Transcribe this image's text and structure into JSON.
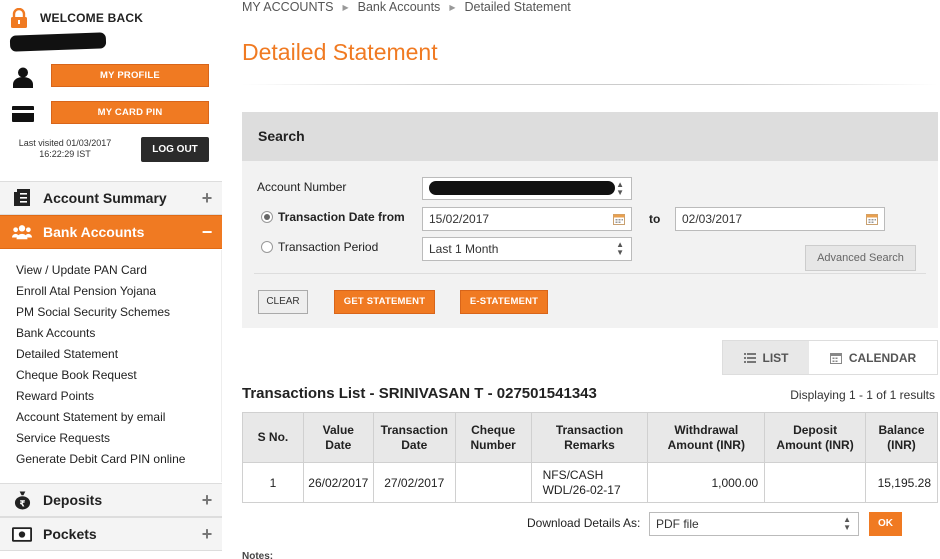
{
  "sidebar": {
    "welcome": "WELCOME BACK",
    "my_profile": "MY PROFILE",
    "my_card_pin": "MY CARD PIN",
    "last_visited_line1": "Last visited 01/03/2017",
    "last_visited_line2": "16:22:29 IST",
    "logout": "LOG OUT",
    "nav": {
      "account_summary": "Account Summary",
      "bank_accounts": "Bank Accounts",
      "deposits": "Deposits",
      "pockets": "Pockets",
      "collapsed_sign": "+",
      "expanded_sign": "−"
    },
    "sub_items": [
      "View / Update PAN Card",
      "Enroll Atal Pension Yojana",
      "PM Social Security Schemes",
      "Bank Accounts",
      "Detailed Statement",
      "Cheque Book Request",
      "Reward Points",
      "Account Statement by email",
      "Service Requests",
      "Generate Debit Card PIN online"
    ]
  },
  "breadcrumb": [
    "MY ACCOUNTS",
    "Bank Accounts",
    "Detailed Statement"
  ],
  "page_title": "Detailed Statement",
  "search": {
    "heading": "Search",
    "account_number_label": "Account Number",
    "date_from_label": "Transaction Date from",
    "date_from": "15/02/2017",
    "to_label": "to",
    "date_to": "02/03/2017",
    "period_label": "Transaction Period",
    "period_value": "Last 1 Month",
    "advanced": "Advanced Search",
    "clear": "CLEAR",
    "get_statement": "GET STATEMENT",
    "e_statement": "E-STATEMENT"
  },
  "view_toggle": {
    "list": "LIST",
    "calendar": "CALENDAR"
  },
  "transactions": {
    "title": "Transactions List - SRINIVASAN T - 027501541343",
    "count": "Displaying 1 - 1 of 1 results",
    "headers": {
      "sno": "S No.",
      "value_date_1": "Value",
      "value_date_2": "Date",
      "tx_date_1": "Transaction",
      "tx_date_2": "Date",
      "cheque_1": "Cheque",
      "cheque_2": "Number",
      "remarks_1": "Transaction",
      "remarks_2": "Remarks",
      "withdrawal_1": "Withdrawal",
      "withdrawal_2": "Amount (INR)",
      "deposit_1": "Deposit",
      "deposit_2": "Amount (INR)",
      "balance_1": "Balance",
      "balance_2": "(INR)"
    },
    "rows": [
      {
        "sno": "1",
        "value_date": "26/02/2017",
        "tx_date": "27/02/2017",
        "cheque": "",
        "remarks_1": "NFS/CASH",
        "remarks_2": "WDL/26-02-17",
        "withdrawal": "1,000.00",
        "deposit": "",
        "balance": "15,195.28"
      }
    ]
  },
  "download": {
    "label": "Download Details As:",
    "format": "PDF file",
    "ok": "OK"
  },
  "notes": "Notes:",
  "colors": {
    "accent": "#f07a22",
    "panel": "#f2f2f2",
    "header_gray": "#dddddd"
  }
}
